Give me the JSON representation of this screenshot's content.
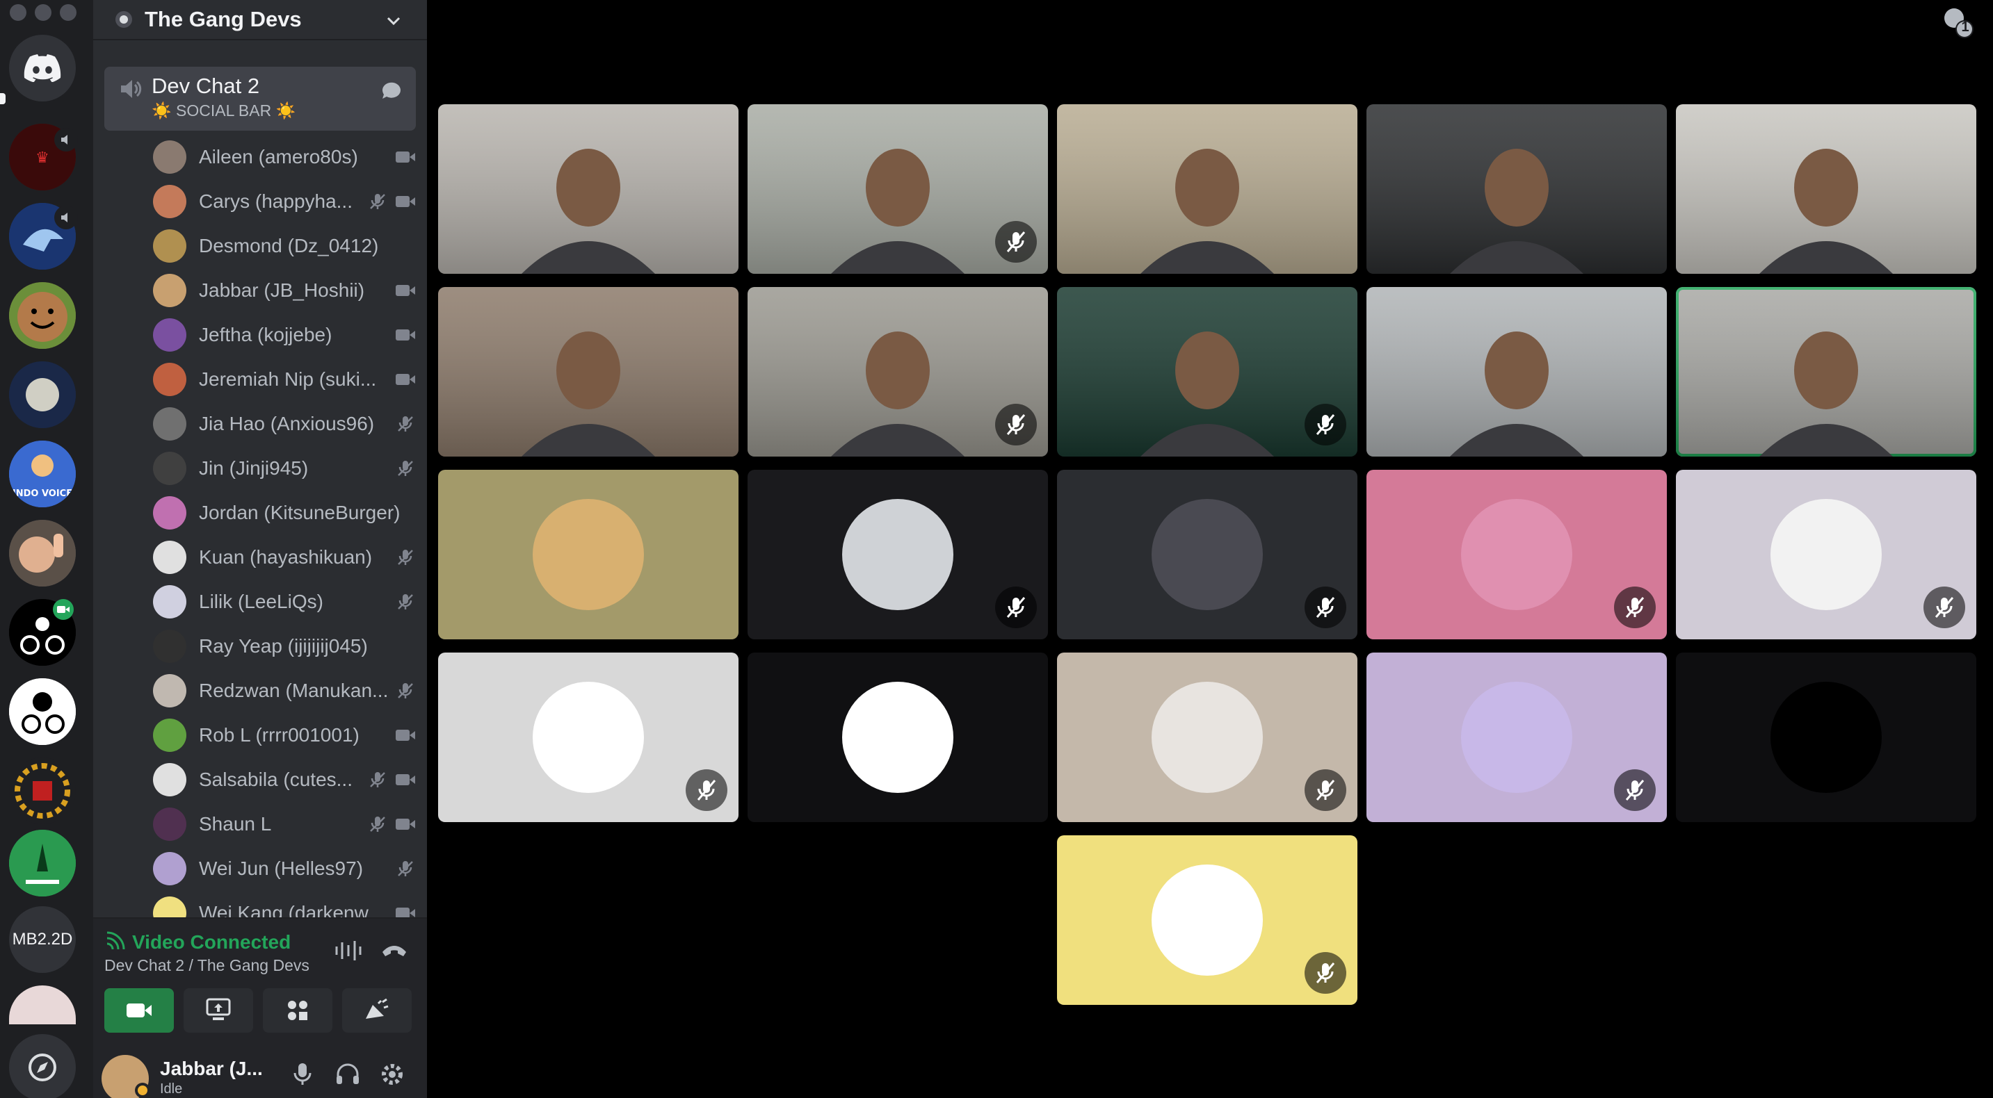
{
  "app": {
    "brand_color": "#5865f2",
    "speaking_color": "#23a55a"
  },
  "rail": {
    "servers": [
      {
        "name": "discord-home"
      },
      {
        "name": "server-red"
      },
      {
        "name": "server-shark"
      },
      {
        "name": "server-smiley"
      },
      {
        "name": "server-moon"
      },
      {
        "name": "server-indo-voice",
        "text": "INDO VOICE"
      },
      {
        "name": "server-wave"
      },
      {
        "name": "server-cyclist"
      },
      {
        "name": "server-cyclist-2"
      },
      {
        "name": "server-gears"
      },
      {
        "name": "server-green"
      },
      {
        "name": "server-mb2",
        "text": "MB2.2D"
      },
      {
        "name": "server-pink"
      },
      {
        "name": "explore"
      }
    ]
  },
  "sidebar": {
    "server_name": "The Gang Devs",
    "channel": {
      "name": "Dev Chat 2",
      "status": "☀️ SOCIAL BAR ☀️"
    },
    "members": [
      {
        "name": "Aileen (amero80s)",
        "muted": false,
        "video": true,
        "color": "#8a7a70"
      },
      {
        "name": "Carys (happyha...",
        "muted": true,
        "video": true,
        "color": "#c47a5a"
      },
      {
        "name": "Desmond (Dz_0412)",
        "muted": false,
        "video": false,
        "color": "#b09050"
      },
      {
        "name": "Jabbar (JB_Hoshii)",
        "muted": false,
        "video": true,
        "color": "#c8a070"
      },
      {
        "name": "Jeftha (kojjebe)",
        "muted": false,
        "video": true,
        "color": "#7a50a0"
      },
      {
        "name": "Jeremiah Nip (suki...",
        "muted": false,
        "video": true,
        "color": "#c06040"
      },
      {
        "name": "Jia Hao (Anxious96)",
        "muted": true,
        "video": false,
        "color": "#707070"
      },
      {
        "name": "Jin (Jinji945)",
        "muted": true,
        "video": false,
        "color": "#404040"
      },
      {
        "name": "Jordan (KitsuneBurger)",
        "muted": false,
        "video": false,
        "color": "#c070b0"
      },
      {
        "name": "Kuan (hayashikuan)",
        "muted": true,
        "video": false,
        "color": "#e0e0e0"
      },
      {
        "name": "Lilik (LeeLiQs)",
        "muted": true,
        "video": false,
        "color": "#d0d0e0"
      },
      {
        "name": "Ray Yeap (ijijijij045)",
        "muted": false,
        "video": false,
        "color": "#303030"
      },
      {
        "name": "Redzwan (Manukan...",
        "muted": true,
        "video": false,
        "color": "#c0b8b0"
      },
      {
        "name": "Rob L (rrrr001001)",
        "muted": false,
        "video": true,
        "color": "#60a040"
      },
      {
        "name": "Salsabila (cutes...",
        "muted": true,
        "video": true,
        "color": "#e0e0e0"
      },
      {
        "name": "Shaun L",
        "muted": true,
        "video": true,
        "color": "#503050"
      },
      {
        "name": "Wei Jun (Helles97)",
        "muted": true,
        "video": false,
        "color": "#b0a0d0"
      },
      {
        "name": "Wei Kang (darkenw...",
        "muted": false,
        "video": true,
        "color": "#f0e080"
      }
    ],
    "voice": {
      "status": "Video Connected",
      "location": "Dev Chat 2 / The Gang Devs"
    },
    "user": {
      "name": "Jabbar (J...",
      "status": "Idle"
    }
  },
  "stage": {
    "inbox_count": "1",
    "tiles": [
      {
        "kind": "video",
        "bg": "#b8b4ae",
        "muted": false,
        "speaking": false
      },
      {
        "kind": "video",
        "bg": "#a8aca4",
        "muted": true,
        "speaking": false
      },
      {
        "kind": "video",
        "bg": "#b8ac92",
        "muted": false,
        "speaking": false
      },
      {
        "kind": "video",
        "bg": "#2c2e30",
        "muted": false,
        "speaking": false
      },
      {
        "kind": "video",
        "bg": "#c8c6c0",
        "muted": false,
        "speaking": false
      },
      {
        "kind": "video",
        "bg": "#8c7a6a",
        "muted": false,
        "speaking": false
      },
      {
        "kind": "video",
        "bg": "#9a9890",
        "muted": true,
        "speaking": false
      },
      {
        "kind": "video",
        "bg": "#1a3a30",
        "muted": true,
        "speaking": false
      },
      {
        "kind": "video",
        "bg": "#b0b4b6",
        "muted": false,
        "speaking": false
      },
      {
        "kind": "video",
        "bg": "#a8a8a4",
        "muted": false,
        "speaking": true
      },
      {
        "kind": "avatar",
        "bg": "#a39a6a",
        "avatar_color": "#d8b070",
        "muted": false
      },
      {
        "kind": "avatar",
        "bg": "#1a1a1d",
        "avatar_color": "#cfd2d6",
        "muted": true
      },
      {
        "kind": "avatar",
        "bg": "#2b2d31",
        "avatar_color": "#4a4a52",
        "muted": true
      },
      {
        "kind": "avatar",
        "bg": "#d47a98",
        "avatar_color": "#e090b0",
        "muted": true
      },
      {
        "kind": "avatar",
        "bg": "#d0cbd6",
        "avatar_color": "#f2f2f2",
        "muted": true
      },
      {
        "kind": "avatar",
        "bg": "#d8d8d8",
        "avatar_color": "#ffffff",
        "muted": true
      },
      {
        "kind": "avatar",
        "bg": "#101012",
        "avatar_color": "#ffffff",
        "muted": false
      },
      {
        "kind": "avatar",
        "bg": "#c4b8aa",
        "avatar_color": "#e8e4e0",
        "muted": true
      },
      {
        "kind": "avatar",
        "bg": "#c2b0d6",
        "avatar_color": "#c8b8e8",
        "muted": true
      },
      {
        "kind": "avatar",
        "bg": "#0e0e10",
        "avatar_color": "#000000",
        "muted": false
      },
      {
        "kind": "avatar",
        "bg": "#f0e07e",
        "avatar_color": "#ffffff",
        "muted": true
      }
    ]
  }
}
